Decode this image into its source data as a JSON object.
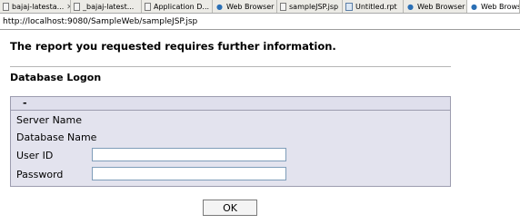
{
  "tabs": [
    {
      "label": "bajaj-latesta...",
      "icon": "document-icon",
      "closable": true,
      "active": false
    },
    {
      "label": "_bajaj-latest...",
      "icon": "document-icon",
      "closable": false,
      "active": false
    },
    {
      "label": "Application D...",
      "icon": "document-icon",
      "closable": false,
      "active": false
    },
    {
      "label": "Web Browser",
      "icon": "globe-icon",
      "closable": false,
      "active": false
    },
    {
      "label": "sampleJSP.jsp",
      "icon": "document-icon",
      "closable": false,
      "active": false
    },
    {
      "label": "Untitled.rpt",
      "icon": "report-icon",
      "closable": false,
      "active": false
    },
    {
      "label": "Web Browser",
      "icon": "globe-icon",
      "closable": false,
      "active": false
    },
    {
      "label": "Web Browser",
      "icon": "globe-icon",
      "closable": false,
      "active": true
    }
  ],
  "address": {
    "url": "http://localhost:9080/SampleWeb/sampleJSP.jsp"
  },
  "page": {
    "heading": "The report you requested requires further information.",
    "section_title": "Database Logon",
    "collapse_symbol": "-",
    "server_name_label": "Server Name",
    "database_name_label": "Database Name",
    "user_id_label": "User ID",
    "user_id_value": "",
    "password_label": "Password",
    "password_value": "",
    "ok_label": "OK"
  },
  "colors": {
    "panel_background": "#e3e3ee",
    "panel_border": "#9c9caf",
    "input_border": "#7f9db9"
  }
}
